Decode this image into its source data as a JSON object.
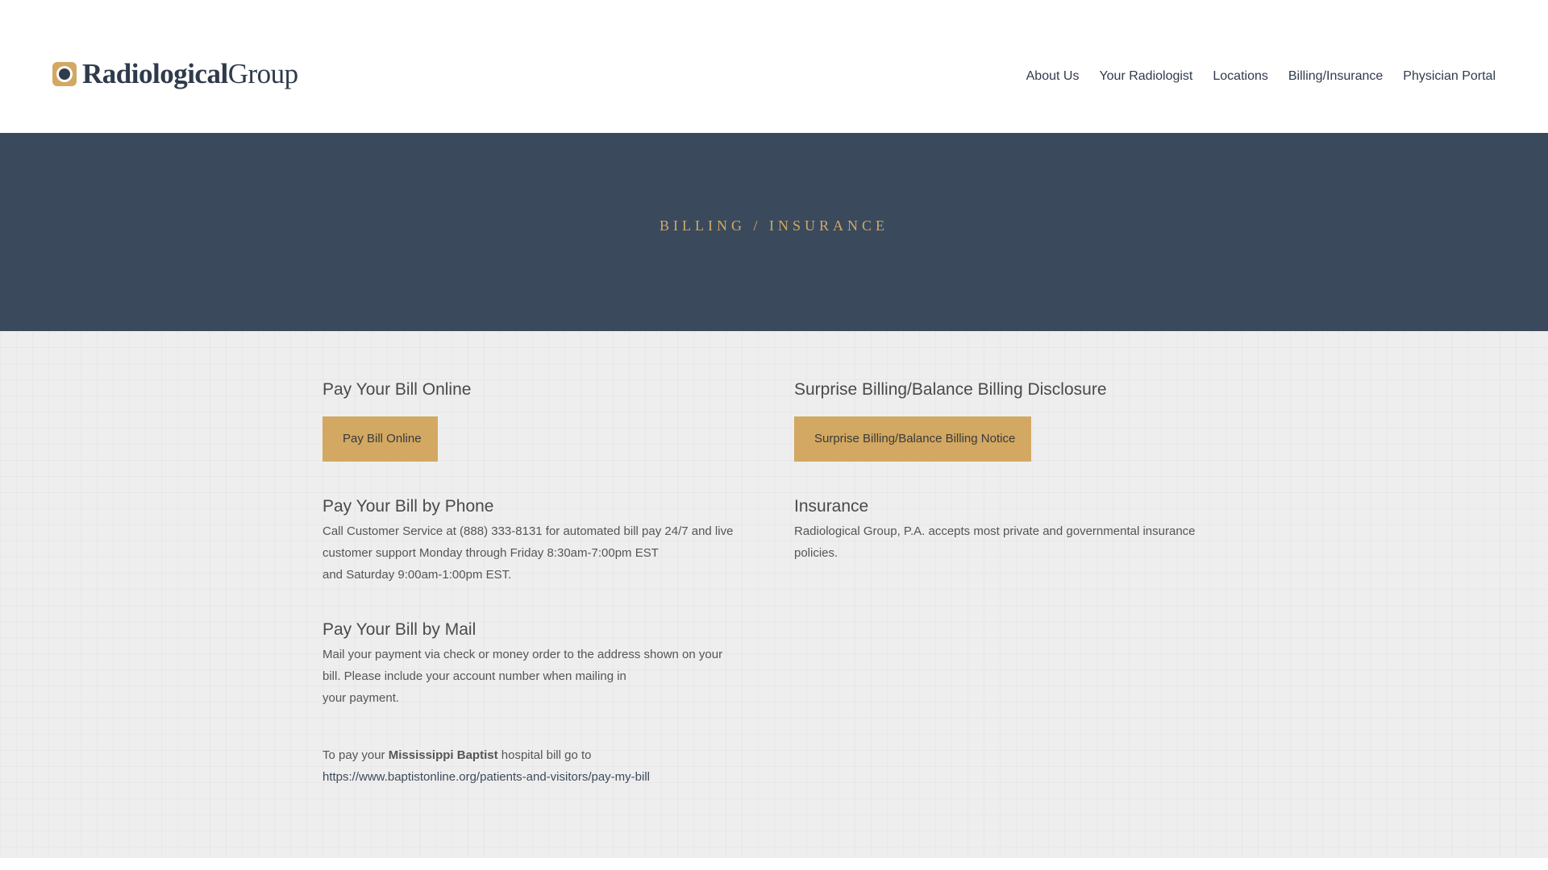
{
  "brand": {
    "name_bold": "Radiological",
    "name_light": "Group",
    "accent_color": "#d2a862",
    "dark_color": "#3a4a5c"
  },
  "nav": {
    "items": [
      "About Us",
      "Your Radiologist",
      "Locations",
      "Billing/Insurance",
      "Physician Portal"
    ]
  },
  "hero": {
    "title": "BILLING / INSURANCE"
  },
  "left": {
    "online": {
      "heading": "Pay Your Bill Online",
      "button": "Pay Bill Online"
    },
    "phone": {
      "heading": "Pay Your Bill by Phone",
      "line1": "Call Customer Service at (888) 333-8131 for automated bill pay 24/7 and live",
      "line2": "customer support Monday through Friday 8:30am-7:00pm EST",
      "line3": "and Saturday 9:00am-1:00pm EST."
    },
    "mail": {
      "heading": "Pay Your Bill by Mail",
      "line1": "Mail your payment via check or money order to the address shown on your",
      "line2": "bill. Please include your account number when mailing in",
      "line3": "your payment."
    },
    "baptist": {
      "prefix": "To pay your ",
      "hospital": "Mississippi Baptist",
      "suffix": " hospital bill go to",
      "link": "https://www.baptistonline.org/patients-and-visitors/pay-my-bill"
    }
  },
  "right": {
    "surprise": {
      "heading": "Surprise Billing/Balance Billing Disclosure",
      "button": "Surprise Billing/Balance Billing Notice"
    },
    "insurance": {
      "heading": "Insurance",
      "line1": "Radiological Group, P.A. accepts most private and governmental insurance",
      "line2": "policies."
    }
  }
}
